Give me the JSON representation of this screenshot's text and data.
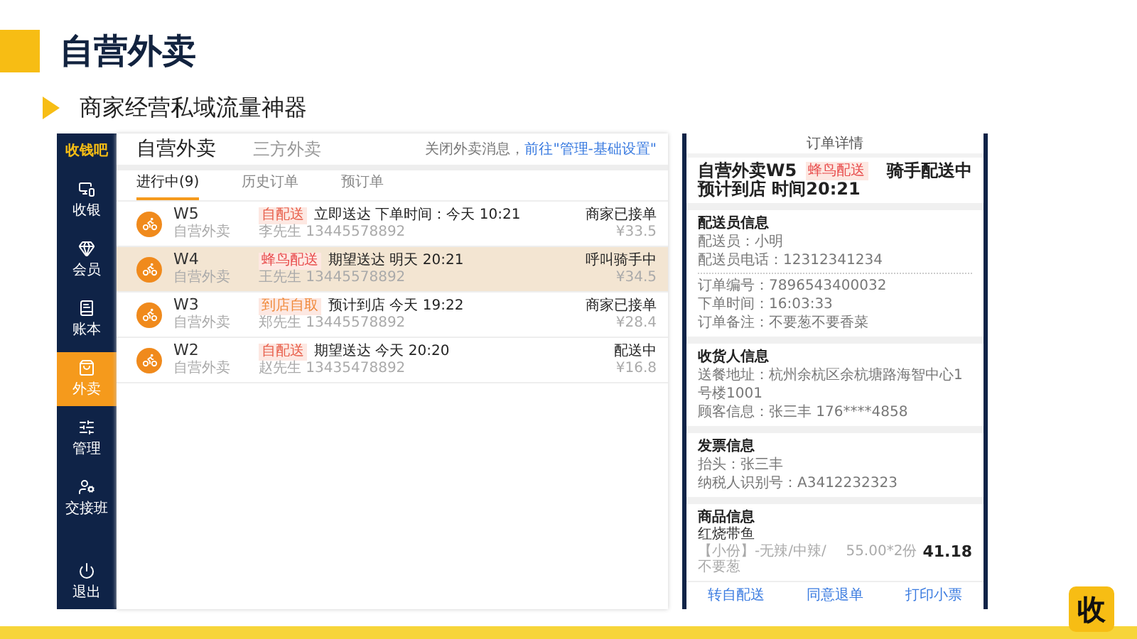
{
  "slide": {
    "title": "自营外卖",
    "subtitle": "商家经营私域流量神器"
  },
  "app": {
    "logo": "收钱吧",
    "sidebar": {
      "items": [
        {
          "label": "收银",
          "selected": false
        },
        {
          "label": "会员",
          "selected": false
        },
        {
          "label": "账本",
          "selected": false
        },
        {
          "label": "外卖",
          "selected": true
        },
        {
          "label": "管理",
          "selected": false
        },
        {
          "label": "交接班",
          "selected": false
        }
      ],
      "bottom": {
        "label": "退出",
        "selected": false
      }
    },
    "tabs": [
      {
        "label": "自营外卖",
        "selected": true
      },
      {
        "label": "三方外卖",
        "selected": false
      }
    ],
    "notice": {
      "text": "关闭外卖消息，",
      "link": "前往\"管理-基础设置\""
    },
    "subtabs": [
      {
        "label": "进行中(9)",
        "selected": true
      },
      {
        "label": "历史订单",
        "selected": false
      },
      {
        "label": "预订单",
        "selected": false
      }
    ],
    "orders": [
      {
        "code": "W5",
        "source": "自营外卖",
        "tag": "自配送",
        "color": "#e8604c",
        "line": "立即送达  下单时间：今天 10:21",
        "customer": "李先生  13445578892",
        "status": "商家已接单",
        "price": "¥33.5",
        "selected": false
      },
      {
        "code": "W4",
        "source": "自营外卖",
        "tag": "蜂鸟配送",
        "color": "#e84c4c",
        "line": "期望送达  明天 20:21",
        "customer": "王先生  13445578892",
        "status": "呼叫骑手中",
        "price": "¥34.5",
        "selected": true
      },
      {
        "code": "W3",
        "source": "自营外卖",
        "tag": "到店自取",
        "color": "#f08a3c",
        "line": "预计到店  今天 19:22",
        "customer": "郑先生  13445578892",
        "status": "商家已接单",
        "price": "¥28.4",
        "selected": false
      },
      {
        "code": "W2",
        "source": "自营外卖",
        "tag": "自配送",
        "color": "#e8604c",
        "line": "期望送达  今天 20:20",
        "customer": "赵先生  13435478892",
        "status": "配送中",
        "price": "¥16.8",
        "selected": false
      }
    ]
  },
  "detail": {
    "header": "订单详情",
    "title": "自营外卖W5",
    "tag": "蜂鸟配送",
    "status": "骑手配送中",
    "eta": "预计到店 时间20:21",
    "sections": [
      {
        "heading": "配送员信息",
        "lines": [
          "配送员：小明",
          "配送员电话：12312341234"
        ],
        "extra": [
          "订单编号：7896543400032",
          "下单时间：16:03:33",
          "订单备注：不要葱不要香菜"
        ]
      },
      {
        "heading": "收货人信息",
        "lines": [
          "送餐地址：杭州余杭区余杭塘路海智中心1号楼1001",
          "顾客信息：张三丰 176****4858"
        ]
      },
      {
        "heading": "发票信息",
        "lines": [
          "抬头：张三丰",
          "纳税人识别号：A3412232323"
        ]
      }
    ],
    "goods": {
      "heading": "商品信息",
      "items": [
        {
          "name": "红烧带鱼",
          "spec": "【小份】-无辣/中辣/不要葱",
          "qty": "55.00*2份",
          "amount": "41.18"
        }
      ]
    },
    "actions": [
      "转自配送",
      "同意退单",
      "打印小票"
    ]
  },
  "badge": "收"
}
